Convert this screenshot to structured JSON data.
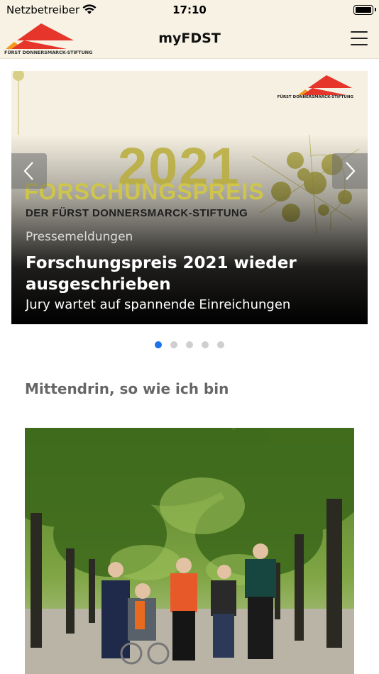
{
  "status_bar": {
    "carrier": "Netzbetreiber",
    "time": "17:10"
  },
  "nav": {
    "title": "myFDST",
    "logo_text": "FÜRST DONNERSMARCK-STIFTUNG",
    "brand_red": "#e6352b",
    "brand_orange": "#f29a1f"
  },
  "slider": {
    "art": {
      "logo_text": "FÜRST DONNERSMARCK-STIFTUNG",
      "year": "2021",
      "headline": "FORSCHUNGSPREIS",
      "subline": "DER FÜRST DONNERSMARCK-STIFTUNG"
    },
    "category": "Pressemeldungen",
    "title": "Forschungspreis 2021 wieder ausgeschrieben",
    "teaser": "Jury wartet auf spannende Einreichungen",
    "page_count": 5,
    "active_page": 1,
    "accent": "#1a73e8"
  },
  "section": {
    "title": "Mittendrin, so wie ich bin"
  }
}
